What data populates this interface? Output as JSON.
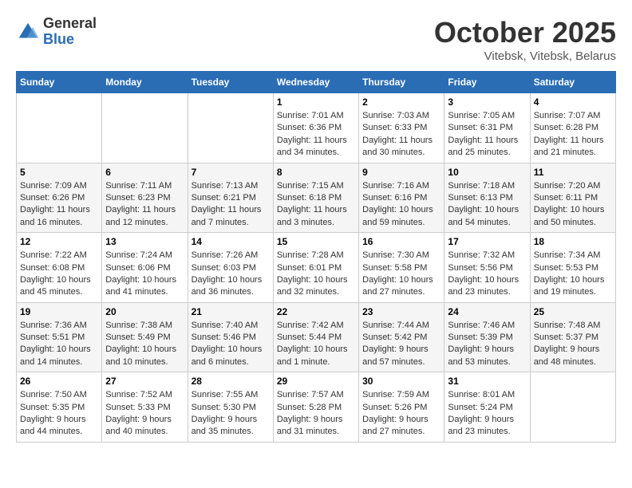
{
  "logo": {
    "general": "General",
    "blue": "Blue"
  },
  "title": "October 2025",
  "location": "Vitebsk, Vitebsk, Belarus",
  "weekdays": [
    "Sunday",
    "Monday",
    "Tuesday",
    "Wednesday",
    "Thursday",
    "Friday",
    "Saturday"
  ],
  "weeks": [
    [
      {
        "day": "",
        "info": ""
      },
      {
        "day": "",
        "info": ""
      },
      {
        "day": "",
        "info": ""
      },
      {
        "day": "1",
        "info": "Sunrise: 7:01 AM\nSunset: 6:36 PM\nDaylight: 11 hours\nand 34 minutes."
      },
      {
        "day": "2",
        "info": "Sunrise: 7:03 AM\nSunset: 6:33 PM\nDaylight: 11 hours\nand 30 minutes."
      },
      {
        "day": "3",
        "info": "Sunrise: 7:05 AM\nSunset: 6:31 PM\nDaylight: 11 hours\nand 25 minutes."
      },
      {
        "day": "4",
        "info": "Sunrise: 7:07 AM\nSunset: 6:28 PM\nDaylight: 11 hours\nand 21 minutes."
      }
    ],
    [
      {
        "day": "5",
        "info": "Sunrise: 7:09 AM\nSunset: 6:26 PM\nDaylight: 11 hours\nand 16 minutes."
      },
      {
        "day": "6",
        "info": "Sunrise: 7:11 AM\nSunset: 6:23 PM\nDaylight: 11 hours\nand 12 minutes."
      },
      {
        "day": "7",
        "info": "Sunrise: 7:13 AM\nSunset: 6:21 PM\nDaylight: 11 hours\nand 7 minutes."
      },
      {
        "day": "8",
        "info": "Sunrise: 7:15 AM\nSunset: 6:18 PM\nDaylight: 11 hours\nand 3 minutes."
      },
      {
        "day": "9",
        "info": "Sunrise: 7:16 AM\nSunset: 6:16 PM\nDaylight: 10 hours\nand 59 minutes."
      },
      {
        "day": "10",
        "info": "Sunrise: 7:18 AM\nSunset: 6:13 PM\nDaylight: 10 hours\nand 54 minutes."
      },
      {
        "day": "11",
        "info": "Sunrise: 7:20 AM\nSunset: 6:11 PM\nDaylight: 10 hours\nand 50 minutes."
      }
    ],
    [
      {
        "day": "12",
        "info": "Sunrise: 7:22 AM\nSunset: 6:08 PM\nDaylight: 10 hours\nand 45 minutes."
      },
      {
        "day": "13",
        "info": "Sunrise: 7:24 AM\nSunset: 6:06 PM\nDaylight: 10 hours\nand 41 minutes."
      },
      {
        "day": "14",
        "info": "Sunrise: 7:26 AM\nSunset: 6:03 PM\nDaylight: 10 hours\nand 36 minutes."
      },
      {
        "day": "15",
        "info": "Sunrise: 7:28 AM\nSunset: 6:01 PM\nDaylight: 10 hours\nand 32 minutes."
      },
      {
        "day": "16",
        "info": "Sunrise: 7:30 AM\nSunset: 5:58 PM\nDaylight: 10 hours\nand 27 minutes."
      },
      {
        "day": "17",
        "info": "Sunrise: 7:32 AM\nSunset: 5:56 PM\nDaylight: 10 hours\nand 23 minutes."
      },
      {
        "day": "18",
        "info": "Sunrise: 7:34 AM\nSunset: 5:53 PM\nDaylight: 10 hours\nand 19 minutes."
      }
    ],
    [
      {
        "day": "19",
        "info": "Sunrise: 7:36 AM\nSunset: 5:51 PM\nDaylight: 10 hours\nand 14 minutes."
      },
      {
        "day": "20",
        "info": "Sunrise: 7:38 AM\nSunset: 5:49 PM\nDaylight: 10 hours\nand 10 minutes."
      },
      {
        "day": "21",
        "info": "Sunrise: 7:40 AM\nSunset: 5:46 PM\nDaylight: 10 hours\nand 6 minutes."
      },
      {
        "day": "22",
        "info": "Sunrise: 7:42 AM\nSunset: 5:44 PM\nDaylight: 10 hours\nand 1 minute."
      },
      {
        "day": "23",
        "info": "Sunrise: 7:44 AM\nSunset: 5:42 PM\nDaylight: 9 hours\nand 57 minutes."
      },
      {
        "day": "24",
        "info": "Sunrise: 7:46 AM\nSunset: 5:39 PM\nDaylight: 9 hours\nand 53 minutes."
      },
      {
        "day": "25",
        "info": "Sunrise: 7:48 AM\nSunset: 5:37 PM\nDaylight: 9 hours\nand 48 minutes."
      }
    ],
    [
      {
        "day": "26",
        "info": "Sunrise: 7:50 AM\nSunset: 5:35 PM\nDaylight: 9 hours\nand 44 minutes."
      },
      {
        "day": "27",
        "info": "Sunrise: 7:52 AM\nSunset: 5:33 PM\nDaylight: 9 hours\nand 40 minutes."
      },
      {
        "day": "28",
        "info": "Sunrise: 7:55 AM\nSunset: 5:30 PM\nDaylight: 9 hours\nand 35 minutes."
      },
      {
        "day": "29",
        "info": "Sunrise: 7:57 AM\nSunset: 5:28 PM\nDaylight: 9 hours\nand 31 minutes."
      },
      {
        "day": "30",
        "info": "Sunrise: 7:59 AM\nSunset: 5:26 PM\nDaylight: 9 hours\nand 27 minutes."
      },
      {
        "day": "31",
        "info": "Sunrise: 8:01 AM\nSunset: 5:24 PM\nDaylight: 9 hours\nand 23 minutes."
      },
      {
        "day": "",
        "info": ""
      }
    ]
  ]
}
